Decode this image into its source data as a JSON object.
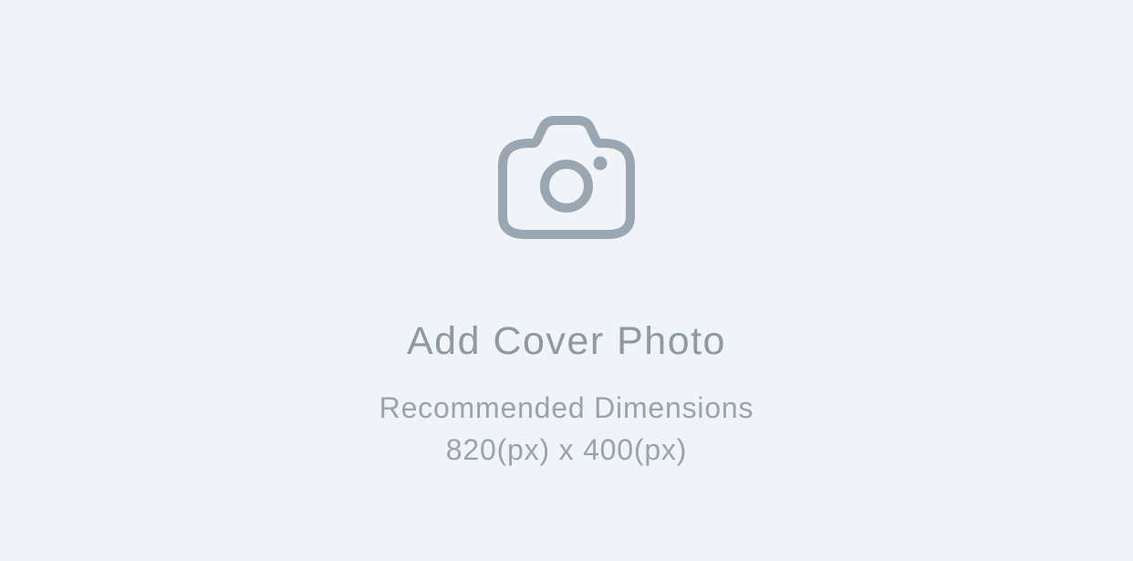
{
  "cover": {
    "icon": "camera-icon",
    "icon_color": "#9aa6b2",
    "background": "#f0f3f8",
    "title": "Add Cover Photo",
    "hint_line1": "Recommended Dimensions",
    "hint_line2": "820(px) x 400(px)"
  }
}
